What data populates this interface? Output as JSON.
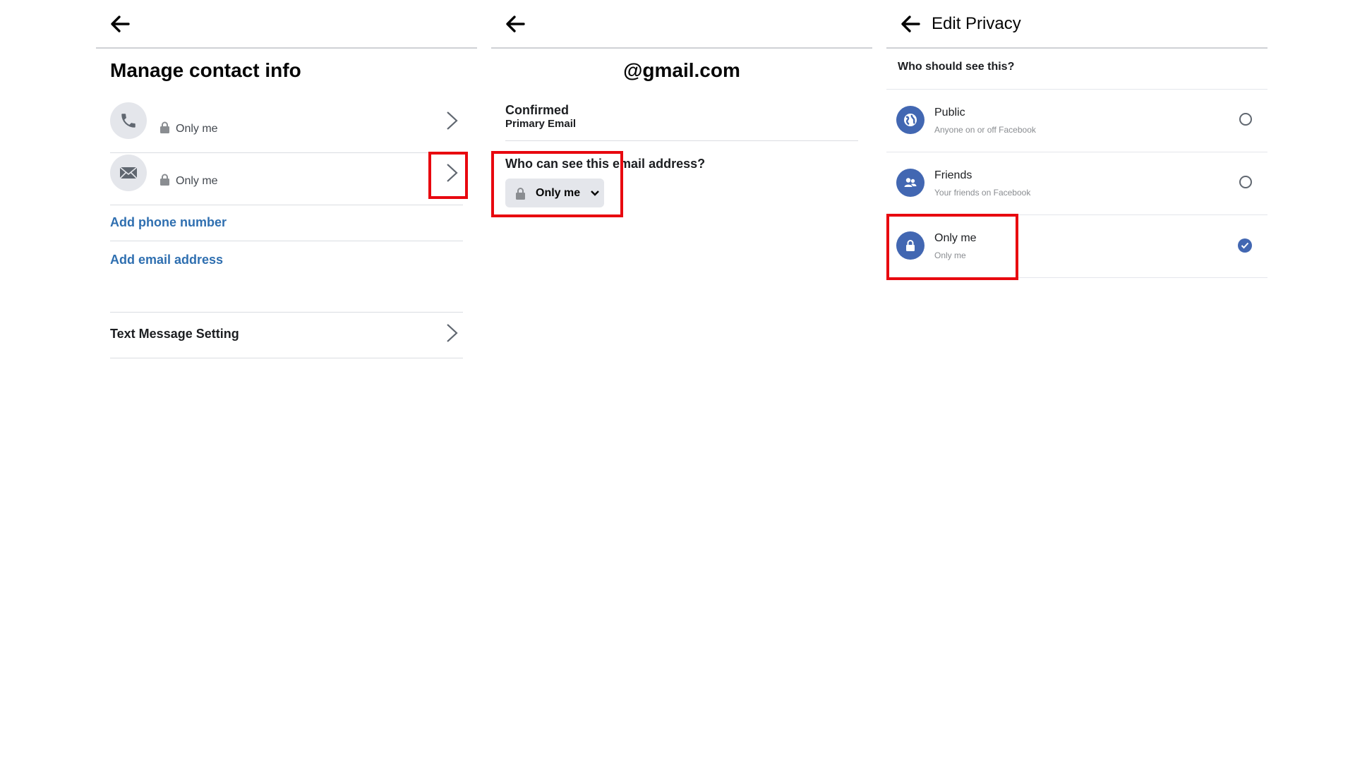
{
  "manage_screen": {
    "title": "Manage contact info",
    "contacts": [
      {
        "icon": "phone-icon",
        "privacy": "Only me"
      },
      {
        "icon": "envelope-icon",
        "privacy": "Only me"
      }
    ],
    "add_phone": "Add phone number",
    "add_email": "Add email address",
    "text_message_setting": "Text Message Setting"
  },
  "email_screen": {
    "email": "@gmail.com",
    "status": "Confirmed",
    "type": "Primary Email",
    "question": "Who can see this email address?",
    "privacy_selected": "Only me"
  },
  "privacy_screen": {
    "title": "Edit Privacy",
    "question": "Who should see this?",
    "options": [
      {
        "label": "Public",
        "sub": "Anyone on or off Facebook",
        "icon": "globe-icon",
        "selected": false
      },
      {
        "label": "Friends",
        "sub": "Your friends on Facebook",
        "icon": "friends-icon",
        "selected": false
      },
      {
        "label": "Only me",
        "sub": "Only me",
        "icon": "lock-icon",
        "selected": true
      }
    ]
  },
  "colors": {
    "accent": "#4267b2",
    "link": "#2f6fb0",
    "highlight": "#e8080f"
  }
}
